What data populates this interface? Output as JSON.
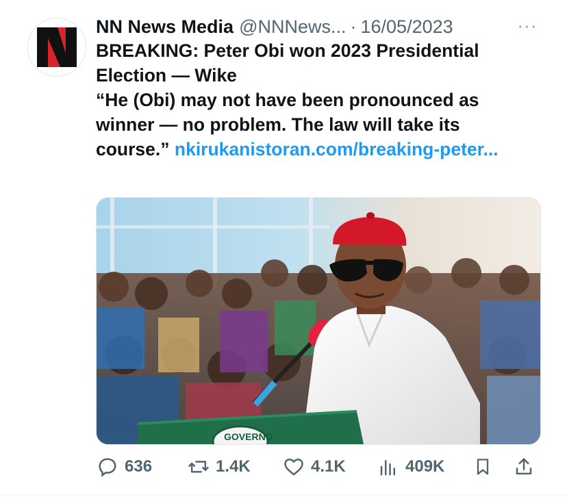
{
  "tweet": {
    "author_name": "NN News Media",
    "author_handle": "@NNNews...",
    "separator": "·",
    "date": "16/05/2023",
    "more_label": "···",
    "headline": "BREAKING: Peter Obi won 2023 Presidential Election — Wike",
    "quote": "“He (Obi) may not have been pronounced as winner — no problem. The law will take its course.”",
    "link": "nkirukanistoran.com/breaking-peter...",
    "avatar_logo_text": "N",
    "media_alt": "Man in red cap and sunglasses speaking at a green podium in front of a seated crowd",
    "podium_text": "GOVERNO"
  },
  "actions": {
    "replies": "636",
    "retweets": "1.4K",
    "likes": "4.1K",
    "views": "409K"
  },
  "colors": {
    "text": "#0f1419",
    "secondary": "#536471",
    "link": "#1d9bf0",
    "logo_red": "#d7232b",
    "logo_black": "#111111",
    "cap_red": "#d3182a",
    "podium_green": "#1f6f4a"
  },
  "icons": [
    "reply-icon",
    "retweet-icon",
    "like-icon",
    "views-icon",
    "bookmark-icon",
    "share-icon",
    "more-icon"
  ]
}
